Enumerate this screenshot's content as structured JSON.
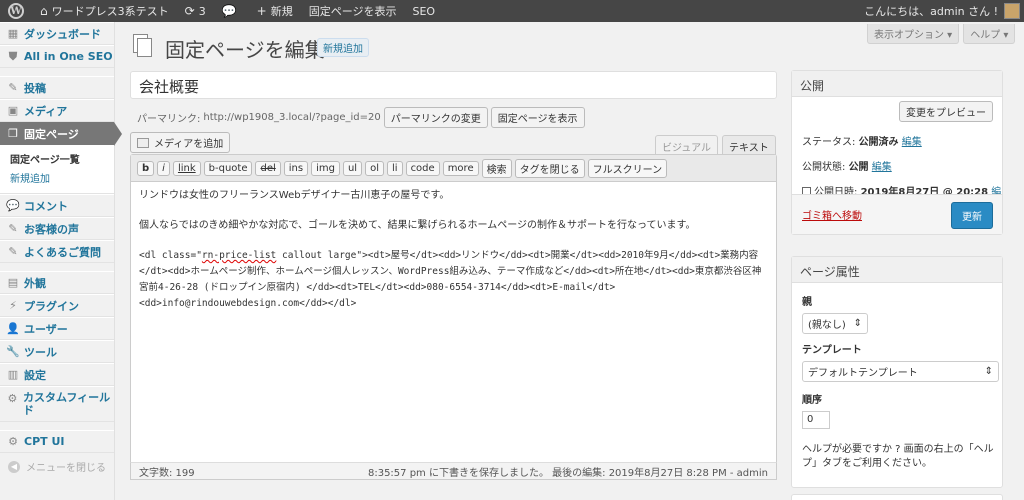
{
  "adminbar": {
    "site_name": "ワードプレス3系テスト",
    "updates_count": "3",
    "new_label": "新規",
    "view_page": "固定ページを表示",
    "seo": "SEO",
    "greeting": "こんにちは、admin さん !"
  },
  "sidebar": {
    "dashboard": "ダッシュボード",
    "aioseo": "All in One SEO",
    "posts": "投稿",
    "media": "メディア",
    "pages": "固定ページ",
    "pages_list": "固定ページ一覧",
    "pages_new": "新規追加",
    "comments": "コメント",
    "testimonials": "お客様の声",
    "faq": "よくあるご質問",
    "appearance": "外観",
    "plugins": "プラグイン",
    "users": "ユーザー",
    "tools": "ツール",
    "settings": "設定",
    "custom_fields": "カスタムフィールド",
    "cptui": "CPT UI",
    "collapse": "メニューを閉じる"
  },
  "header": {
    "screen_options": "表示オプション ▾",
    "help": "ヘルプ ▾",
    "title": "固定ページを編集",
    "add_new": "新規追加"
  },
  "editor": {
    "post_title": "会社概要",
    "permalink_label": "パーマリンク:",
    "permalink_url": "http://wp1908_3.local/?page_id=20",
    "change_permalink": "パーマリンクの変更",
    "view_page": "固定ページを表示",
    "add_media": "メディアを追加",
    "tab_visual": "ビジュアル",
    "tab_text": "テキスト",
    "quicktags": [
      "b",
      "i",
      "link",
      "b-quote",
      "del",
      "ins",
      "img",
      "ul",
      "ol",
      "li",
      "code",
      "more",
      "検索",
      "タグを閉じる",
      "フルスクリーン"
    ],
    "line1": "リンドウは女性のフリーランスWebデザイナー古川恵子の屋号です。",
    "line2": "個人ならではのきめ細やかな対応で、ゴールを決めて、結果に繋げられるホームページの制作＆サポートを行なっています。",
    "code_pre": "<dl class=\"",
    "code_class": "rn-price-list",
    "code_post": " callout large\"><dt>屋号</dt><dd>リンドウ</dd><dt>開業</dt><dd>2010年9月</dd><dt>業務内容</dt><dd>ホームページ制作、ホームページ個人レッスン、WordPress組み込み、テーマ作成など</dd><dt>所在地</dt><dd>東京都渋谷区神宮前4-26-28 (ドロップイン原宿内) </dd><dt>TEL</dt><dd>080-6554-3714</dd><dt>E-mail</dt><dd>info@rindouwebdesign.com</dd></dl>",
    "word_count": "文字数: 199",
    "save_status": "8:35:57 pm に下書きを保存しました。 最後の編集: 2019年8月27日 8:28 PM - admin"
  },
  "publish": {
    "heading": "公開",
    "preview": "変更をプレビュー",
    "status_label": "ステータス: ",
    "status_value": "公開済み",
    "edit": "編集",
    "visibility_label": "公開状態: ",
    "visibility_value": "公開",
    "date_label": "公開日時: ",
    "date_value": "2019年8月27日 @ 20:28",
    "trash": "ゴミ箱へ移動",
    "update": "更新"
  },
  "attributes": {
    "heading": "ページ属性",
    "parent_label": "親",
    "parent_value": "(親なし)",
    "template_label": "テンプレート",
    "template_value": "デフォルトテンプレート",
    "order_label": "順序",
    "order_value": "0",
    "help": "ヘルプが必要ですか ? 画面の右上の「ヘルプ」タブをご利用ください。"
  }
}
